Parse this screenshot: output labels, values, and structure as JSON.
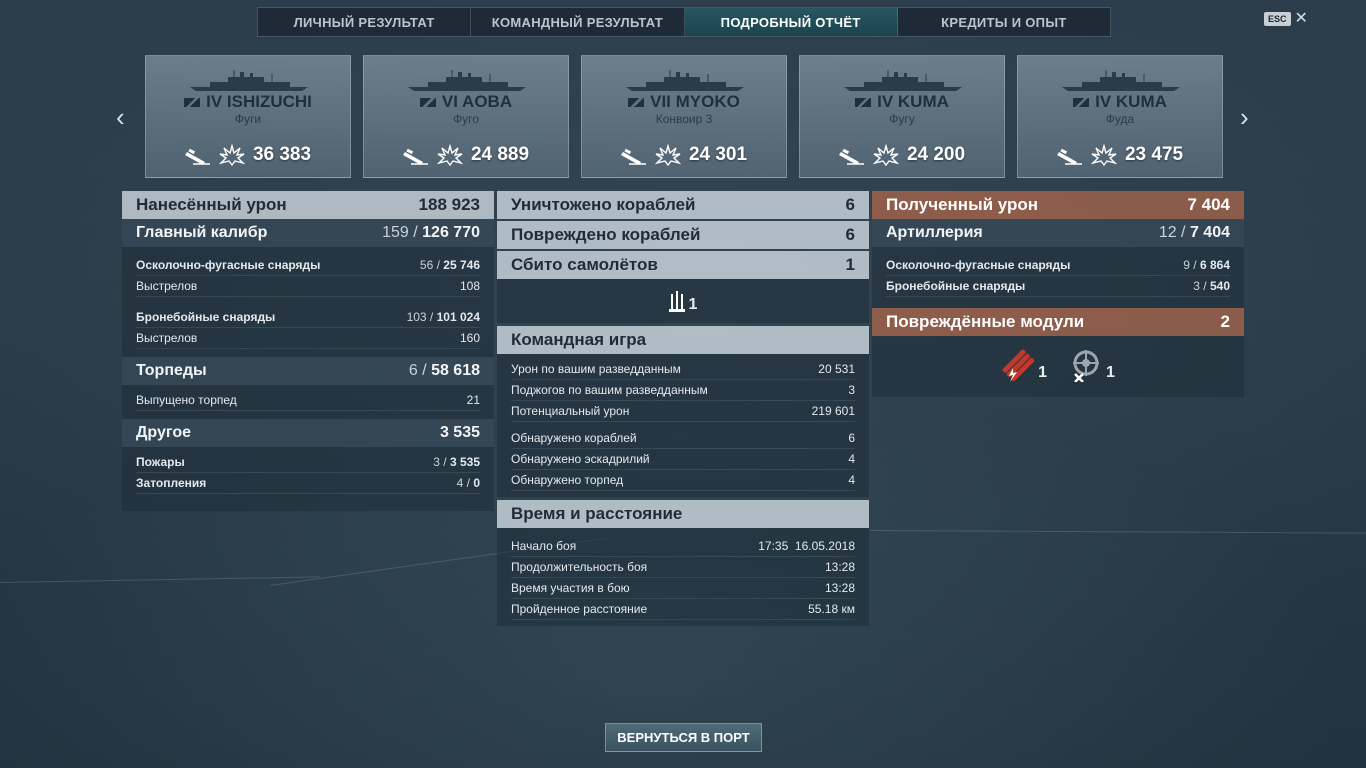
{
  "tabs": [
    {
      "label": "ЛИЧНЫЙ РЕЗУЛЬТАТ"
    },
    {
      "label": "КОМАНДНЫЙ РЕЗУЛЬТАТ"
    },
    {
      "label": "ПОДРОБНЫЙ ОТЧЁТ"
    },
    {
      "label": "КРЕДИТЫ И ОПЫТ"
    }
  ],
  "esc_label": "ESC",
  "ships": [
    {
      "name": "IV ISHIZUCHI",
      "mode": "Фуги",
      "damage": "36 383"
    },
    {
      "name": "VI AOBA",
      "mode": "Фуго",
      "damage": "24 889"
    },
    {
      "name": "VII MYOKO",
      "mode": "Конвоир 3",
      "damage": "24 301"
    },
    {
      "name": "IV KUMA",
      "mode": "Фугу",
      "damage": "24 200"
    },
    {
      "name": "IV KUMA",
      "mode": "Фуда",
      "damage": "23 475"
    }
  ],
  "left": {
    "damage_title": "Нанесённый урон",
    "damage_total": "188 923",
    "main": {
      "label": "Главный калибр",
      "hits": "159",
      "damage": "126 770"
    },
    "he": {
      "label": "Осколочно-фугасные снаряды",
      "hits": "56",
      "damage": "25 746",
      "shots_label": "Выстрелов",
      "shots": "108"
    },
    "ap": {
      "label": "Бронебойные снаряды",
      "hits": "103",
      "damage": "101 024",
      "shots_label": "Выстрелов",
      "shots": "160"
    },
    "torp": {
      "label": "Торпеды",
      "hits": "6",
      "damage": "58 618",
      "launched_label": "Выпущено торпед",
      "launched": "21"
    },
    "other": {
      "label": "Другое",
      "total": "3 535",
      "fires_label": "Пожары",
      "fires_count": "3",
      "fires_dmg": "3 535",
      "flood_label": "Затопления",
      "flood_count": "4",
      "flood_dmg": "0"
    }
  },
  "mid": {
    "destroyed_label": "Уничтожено кораблей",
    "destroyed": "6",
    "damaged_label": "Повреждено кораблей",
    "damaged": "6",
    "planes_label": "Сбито самолётов",
    "planes": "1",
    "planes_icon_count": "1",
    "team_title": "Командная игра",
    "team_rows": [
      {
        "label": "Урон по вашим разведданным",
        "value": "20 531"
      },
      {
        "label": "Поджогов по вашим разведданным",
        "value": "3"
      },
      {
        "label": "Потенциальный урон",
        "value": "219 601"
      }
    ],
    "spot_rows": [
      {
        "label": "Обнаружено кораблей",
        "value": "6"
      },
      {
        "label": "Обнаружено эскадрилий",
        "value": "4"
      },
      {
        "label": "Обнаружено торпед",
        "value": "4"
      }
    ],
    "time_title": "Время и расстояние",
    "time_rows": [
      {
        "label": "Начало боя",
        "value": "17:35  16.05.2018"
      },
      {
        "label": "Продолжительность боя",
        "value": "13:28"
      },
      {
        "label": "Время участия в бою",
        "value": "13:28"
      },
      {
        "label": "Пройденное расстояние",
        "value": "55.18 км"
      }
    ]
  },
  "right": {
    "received_title": "Полученный урон",
    "received_total": "7 404",
    "art": {
      "label": "Артиллерия",
      "hits": "12",
      "damage": "7 404"
    },
    "he": {
      "label": "Осколочно-фугасные снаряды",
      "hits": "9",
      "damage": "6 864"
    },
    "ap": {
      "label": "Бронебойные снаряды",
      "hits": "3",
      "damage": "540"
    },
    "modules_title": "Повреждённые модули",
    "modules_total": "2",
    "module_counts": [
      "1",
      "1"
    ]
  },
  "return_button": "ВЕРНУТЬСЯ В ПОРТ",
  "colors": {
    "accent_tab": "#285a64",
    "received_header": "#96604b"
  }
}
